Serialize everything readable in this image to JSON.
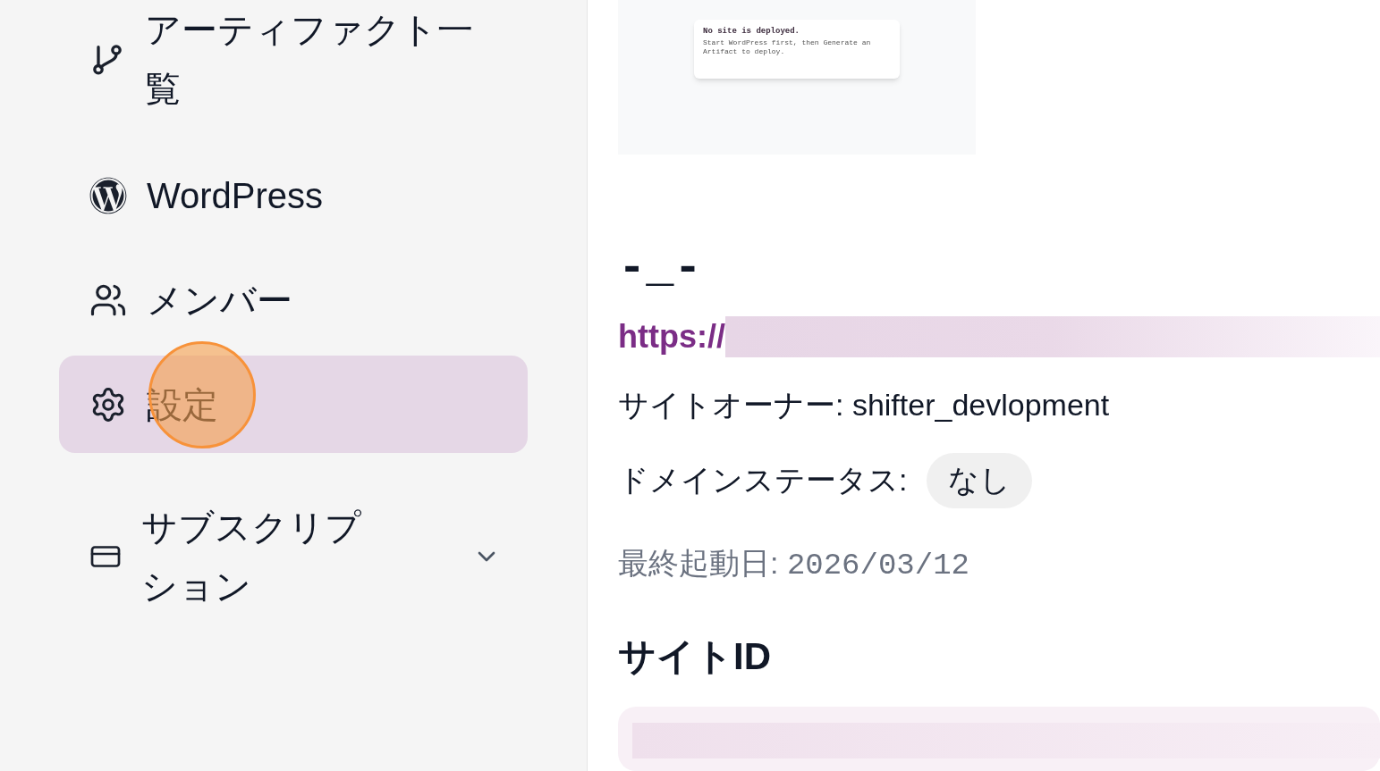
{
  "sidebar": {
    "items": [
      {
        "kind": "branch",
        "label": "アーティファクト一覧",
        "selected": false
      },
      {
        "kind": "wordpress",
        "label": "WordPress",
        "selected": false
      },
      {
        "kind": "members",
        "label": "メンバー",
        "selected": false
      },
      {
        "kind": "settings",
        "label": "設定",
        "selected": true
      },
      {
        "kind": "subscription",
        "label": "サブスクリプション",
        "selected": false,
        "expanded": false
      }
    ]
  },
  "preview": {
    "title": "No site is deployed.",
    "message": "Start WordPress first, then Generate an Artifact to deploy."
  },
  "site": {
    "name": "-_-",
    "url_prefix": "https://",
    "owner_label": "サイトオーナー:",
    "owner": "shifter_devlopment",
    "domain_status_label": "ドメインステータス:",
    "domain_status": "なし",
    "last_launch_label": "最終起動日:",
    "last_launch": "2026/03/12"
  },
  "site_id": {
    "heading": "サイトID"
  }
}
